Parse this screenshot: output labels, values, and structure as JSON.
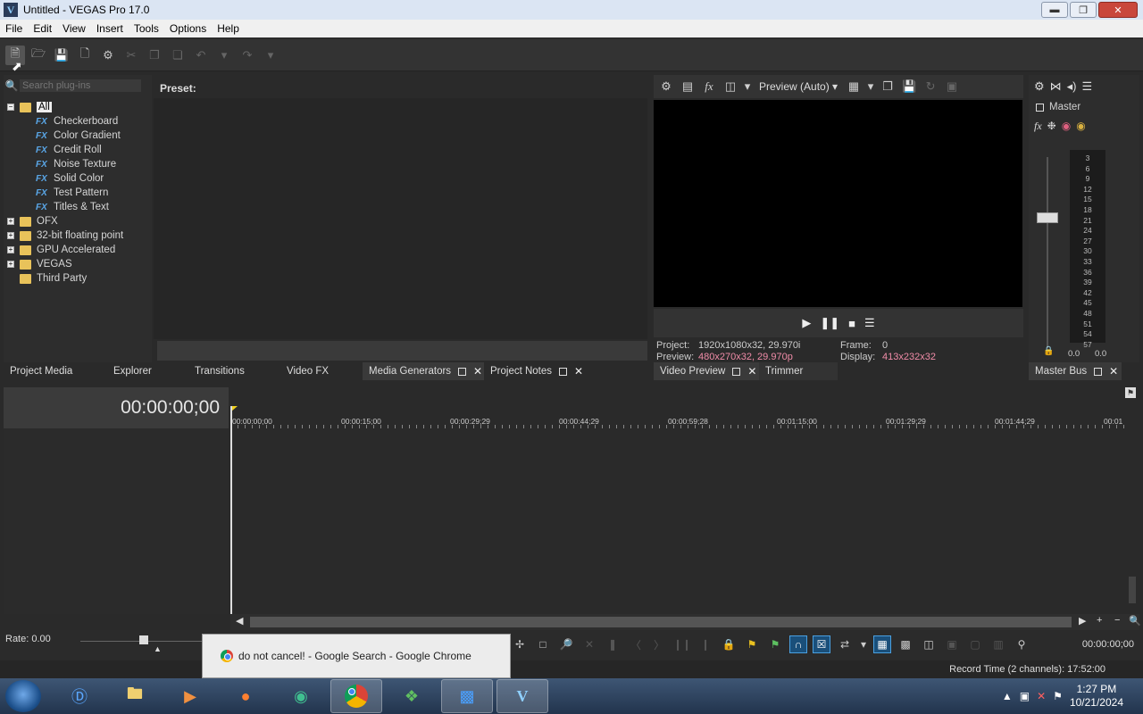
{
  "window": {
    "title": "Untitled - VEGAS Pro 17.0",
    "app_letter": "V"
  },
  "menu": [
    "File",
    "Edit",
    "View",
    "Insert",
    "Tools",
    "Options",
    "Help"
  ],
  "plugins": {
    "search_placeholder": "Search plug-ins",
    "tree": [
      {
        "label": "All",
        "type": "folder",
        "expand": "−",
        "selected": true
      },
      {
        "label": "Checkerboard",
        "type": "fx"
      },
      {
        "label": "Color Gradient",
        "type": "fx"
      },
      {
        "label": "Credit Roll",
        "type": "fx"
      },
      {
        "label": "Noise Texture",
        "type": "fx"
      },
      {
        "label": "Solid Color",
        "type": "fx"
      },
      {
        "label": "Test Pattern",
        "type": "fx"
      },
      {
        "label": "Titles & Text",
        "type": "fx"
      },
      {
        "label": "OFX",
        "type": "folder",
        "expand": "+"
      },
      {
        "label": "32-bit floating point",
        "type": "folder",
        "expand": "+"
      },
      {
        "label": "GPU Accelerated",
        "type": "folder",
        "expand": "+"
      },
      {
        "label": "VEGAS",
        "type": "folder",
        "expand": "+"
      },
      {
        "label": "Third Party",
        "type": "folder",
        "expand": ""
      }
    ],
    "fx_badge": "FX"
  },
  "preset": {
    "label": "Preset:"
  },
  "preview": {
    "mode": "Preview (Auto)",
    "project_label": "Project:",
    "project_value": "1920x1080x32, 29.970i",
    "preview_label": "Preview:",
    "preview_value": "480x270x32, 29.970p",
    "frame_label": "Frame:",
    "frame_value": "0",
    "display_label": "Display:",
    "display_value": "413x232x32"
  },
  "master": {
    "label": "Master",
    "meter_ticks": [
      "3",
      "6",
      "9",
      "12",
      "15",
      "18",
      "21",
      "24",
      "27",
      "30",
      "33",
      "36",
      "39",
      "42",
      "45",
      "48",
      "51",
      "54",
      "57"
    ],
    "level_left": "0.0",
    "level_right": "0.0"
  },
  "tabs": {
    "project_media": "Project Media",
    "explorer": "Explorer",
    "transitions": "Transitions",
    "video_fx": "Video FX",
    "media_generators": "Media Generators",
    "project_notes": "Project Notes",
    "video_preview": "Video Preview",
    "trimmer": "Trimmer",
    "master_bus": "Master Bus"
  },
  "timeline": {
    "timecode": "00:00:00;00",
    "ruler": [
      "00:00:00;00",
      "00:00:15;00",
      "00:00:29;29",
      "00:00:44;29",
      "00:00:59;28",
      "00:01:15;00",
      "00:01:29;29",
      "00:01:44;29",
      "00:01"
    ]
  },
  "bottom": {
    "rate": "Rate: 0.00",
    "end_time": "00:00:00;00",
    "record_time": "Record Time (2 channels): 17:52:00"
  },
  "tooltip": {
    "text": "do not cancel! - Google Search - Google Chrome"
  },
  "taskbar": {
    "time": "1:27 PM",
    "date": "10/21/2024"
  }
}
